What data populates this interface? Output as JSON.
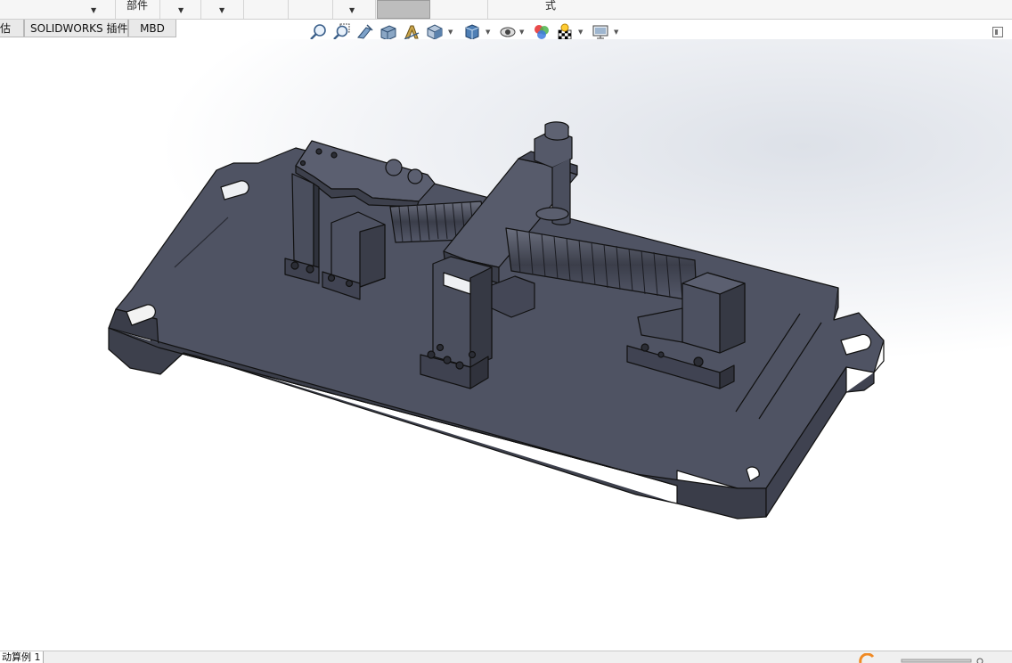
{
  "ribbon": {
    "label_part": "部件",
    "label_style": "式"
  },
  "tabs": [
    {
      "label": "估"
    },
    {
      "label": "SOLIDWORKS 插件"
    },
    {
      "label": "MBD"
    }
  ],
  "view_toolbar": {
    "icons": [
      "zoom-to-fit-icon",
      "zoom-to-area-icon",
      "previous-view-icon",
      "section-view-icon",
      "dynamic-annotation-icon",
      "view-orientation-icon",
      "display-style-icon",
      "hide-show-items-icon",
      "edit-appearance-icon",
      "apply-scene-icon",
      "view-settings-icon"
    ]
  },
  "status_bar": {
    "config_tab": "动算例 1"
  },
  "colors": {
    "model_face": "#4b4f5e",
    "model_edge": "#111111",
    "background_top": "#dde1e8",
    "background_bottom": "#ffffff"
  }
}
